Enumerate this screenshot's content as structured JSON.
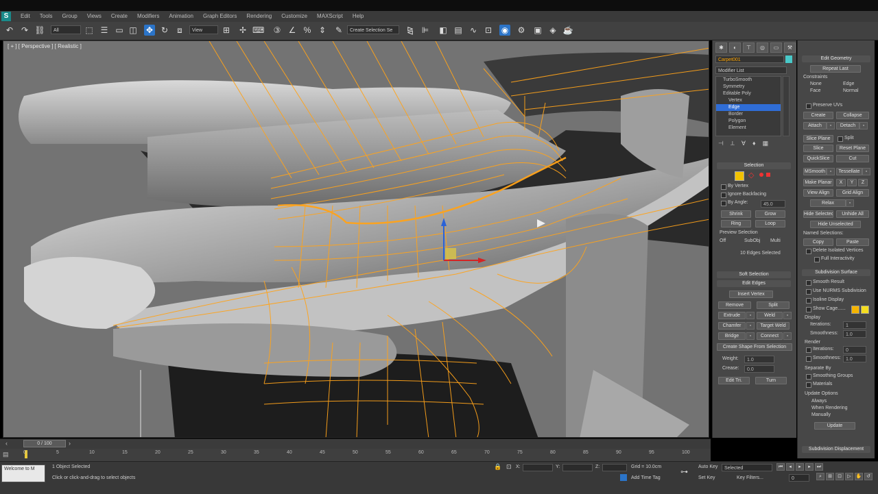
{
  "app": {
    "menu": [
      "Edit",
      "Tools",
      "Group",
      "Views",
      "Create",
      "Modifiers",
      "Animation",
      "Graph Editors",
      "Rendering",
      "Customize",
      "MAXScript",
      "Help"
    ]
  },
  "toolbar": {
    "selection_filter": "All",
    "view_dropdown": "View",
    "named_selection": "Create Selection Se"
  },
  "viewport": {
    "label": "[ + ] [ Perspective ] [ Realistic ]"
  },
  "command_panel": {
    "object_name": "Carpet001",
    "modifier_list": "Modifier List",
    "stack_items": [
      "TurboSmooth",
      "Symmetry",
      "Editable Poly",
      "Vertex",
      "Edge",
      "Border",
      "Polygon",
      "Element"
    ],
    "stack_selected_index": 4,
    "selection": {
      "header": "Selection",
      "by_vertex": "By Vertex",
      "ignore_backfacing": "Ignore Backfacing",
      "by_angle": "By Angle:",
      "by_angle_value": "45.0",
      "shrink": "Shrink",
      "grow": "Grow",
      "ring": "Ring",
      "loop": "Loop",
      "preview_selection": "Preview Selection",
      "preview_options": [
        "Off",
        "SubObj",
        "Multi"
      ],
      "status": "10 Edges Selected"
    },
    "soft_selection": {
      "header": "Soft Selection"
    },
    "edit_edges": {
      "header": "Edit Edges",
      "insert_vertex": "Insert Vertex",
      "remove": "Remove",
      "split": "Split",
      "extrude": "Extrude",
      "weld": "Weld",
      "chamfer": "Chamfer",
      "target_weld": "Target Weld",
      "bridge": "Bridge",
      "connect": "Connect",
      "create_shape": "Create Shape From Selection",
      "weight_label": "Weight:",
      "weight_value": "1.0",
      "crease_label": "Crease:",
      "crease_value": "0.0",
      "edit_tri": "Edit Tri.",
      "turn": "Turn"
    }
  },
  "edit_geometry": {
    "header": "Edit Geometry",
    "repeat_last": "Repeat Last",
    "constraints": "Constraints",
    "constraint_options": [
      "None",
      "Edge",
      "Face",
      "Normal"
    ],
    "preserve_uvs": "Preserve UVs",
    "create": "Create",
    "collapse": "Collapse",
    "attach": "Attach",
    "detach": "Detach",
    "slice_plane": "Slice Plane",
    "split": "Split",
    "slice": "Slice",
    "reset_plane": "Reset Plane",
    "quickslice": "QuickSlice",
    "cut": "Cut",
    "meshsmooth": "MSmooth",
    "tessellate": "Tessellate",
    "make_planar": "Make Planar",
    "xyz": [
      "X",
      "Y",
      "Z"
    ],
    "view_align": "View Align",
    "grid_align": "Grid Align",
    "relax": "Relax",
    "hide_selected": "Hide Selected",
    "unhide_all": "Unhide All",
    "hide_unselected": "Hide Unselected",
    "named_selections": "Named Selections:",
    "copy": "Copy",
    "paste": "Paste",
    "delete_isolated": "Delete Isolated Vertices",
    "full_interactivity": "Full Interactivity"
  },
  "subdivision_surface": {
    "header": "Subdivision Surface",
    "smooth_result": "Smooth Result",
    "use_nurms": "Use NURMS Subdivision",
    "isoline_display": "Isoline Display",
    "show_cage": "Show Cage......",
    "cage_colors": [
      "#f5b400",
      "#f5dd20"
    ],
    "display": "Display",
    "iterations": "Iterations:",
    "iterations_value": "1",
    "smoothness": "Smoothness:",
    "smoothness_value": "1.0",
    "render": "Render",
    "render_iterations": "Iterations:",
    "render_iterations_value": "0",
    "render_smoothness": "Smoothness:",
    "render_smoothness_value": "1.0",
    "separate_by": "Separate By",
    "smoothing_groups": "Smoothing Groups",
    "materials": "Materials",
    "update_options": "Update Options",
    "always": "Always",
    "when_rendering": "When Rendering",
    "manually": "Manually",
    "update": "Update",
    "subdivision_displacement": "Subdivision Displacement"
  },
  "timeline": {
    "frame_label": "0 / 100",
    "ticks": [
      "0",
      "5",
      "10",
      "15",
      "20",
      "25",
      "30",
      "35",
      "40",
      "45",
      "50",
      "55",
      "60",
      "65",
      "70",
      "75",
      "80",
      "85",
      "90",
      "95",
      "100"
    ]
  },
  "status_bar": {
    "script_prompt": "Welcome to M",
    "objects_selected": "1 Object Selected",
    "hint": "Click or click-and-drag to select objects",
    "x_label": "X:",
    "y_label": "Y:",
    "z_label": "Z:",
    "grid": "Grid = 10.0cm",
    "add_time_tag": "Add Time Tag",
    "auto_key": "Auto Key",
    "set_key": "Set Key",
    "selected_dropdown": "Selected",
    "key_filters": "Key Filters...",
    "frame_value": "0"
  },
  "colors": {
    "selection_orange": "#ffa31a",
    "cage_yellow": "#f5b400",
    "active_blue": "#2b74c8",
    "stack_select_blue": "#2f6dd6",
    "panel_bg": "#474747"
  }
}
